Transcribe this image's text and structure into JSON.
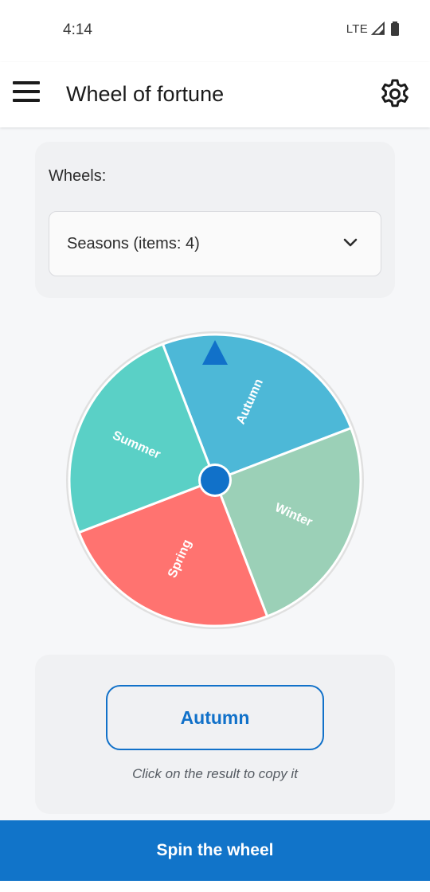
{
  "status_bar": {
    "time": "4:14",
    "network": "LTE",
    "icons": [
      "signal-icon",
      "battery-icon"
    ]
  },
  "app_bar": {
    "title": "Wheel of fortune",
    "menu_icon": "hamburger-menu-icon",
    "settings_icon": "gear-icon"
  },
  "wheels_panel": {
    "label": "Wheels:",
    "selected": "Seasons (items: 4)",
    "dropdown_icon": "chevron-down-icon"
  },
  "wheel": {
    "segments": [
      {
        "label": "Autumn",
        "color": "#4db8d7"
      },
      {
        "label": "Winter",
        "color": "#9bd0b7"
      },
      {
        "label": "Spring",
        "color": "#ff7370"
      },
      {
        "label": "Summer",
        "color": "#5ad0c6"
      }
    ],
    "pointer_color": "#1171c9",
    "hub_color": "#1171c9",
    "rim_color": "#e0e0e0"
  },
  "result": {
    "value": "Autumn",
    "hint": "Click on the result to copy it"
  },
  "spin_button": {
    "label": "Spin the wheel"
  },
  "colors": {
    "accent": "#1171c9",
    "background": "#f6f7f9",
    "card": "#f0f1f3"
  }
}
